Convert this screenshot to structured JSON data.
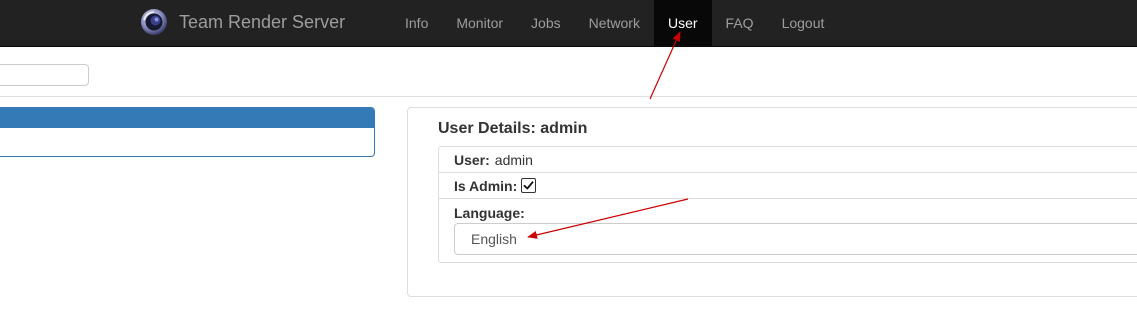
{
  "app": {
    "brand": "Team Render Server",
    "brand_icon": "cinema4d-logo-icon"
  },
  "nav": {
    "items": [
      {
        "label": "Info"
      },
      {
        "label": "Monitor"
      },
      {
        "label": "Jobs"
      },
      {
        "label": "Network"
      },
      {
        "label": "User",
        "active": true
      },
      {
        "label": "FAQ"
      },
      {
        "label": "Logout"
      }
    ]
  },
  "search": {
    "value": "",
    "placeholder": ""
  },
  "user_details": {
    "title": "User Details: admin",
    "user_label": "User:",
    "user_value": "admin",
    "is_admin_label": "Is Admin:",
    "is_admin": true,
    "language_label": "Language:",
    "language_value": "English"
  },
  "colors": {
    "navbar_bg": "#222222",
    "nav_active_bg": "#080808",
    "primary": "#337ab7",
    "annotation_arrow": "#cc0000"
  }
}
